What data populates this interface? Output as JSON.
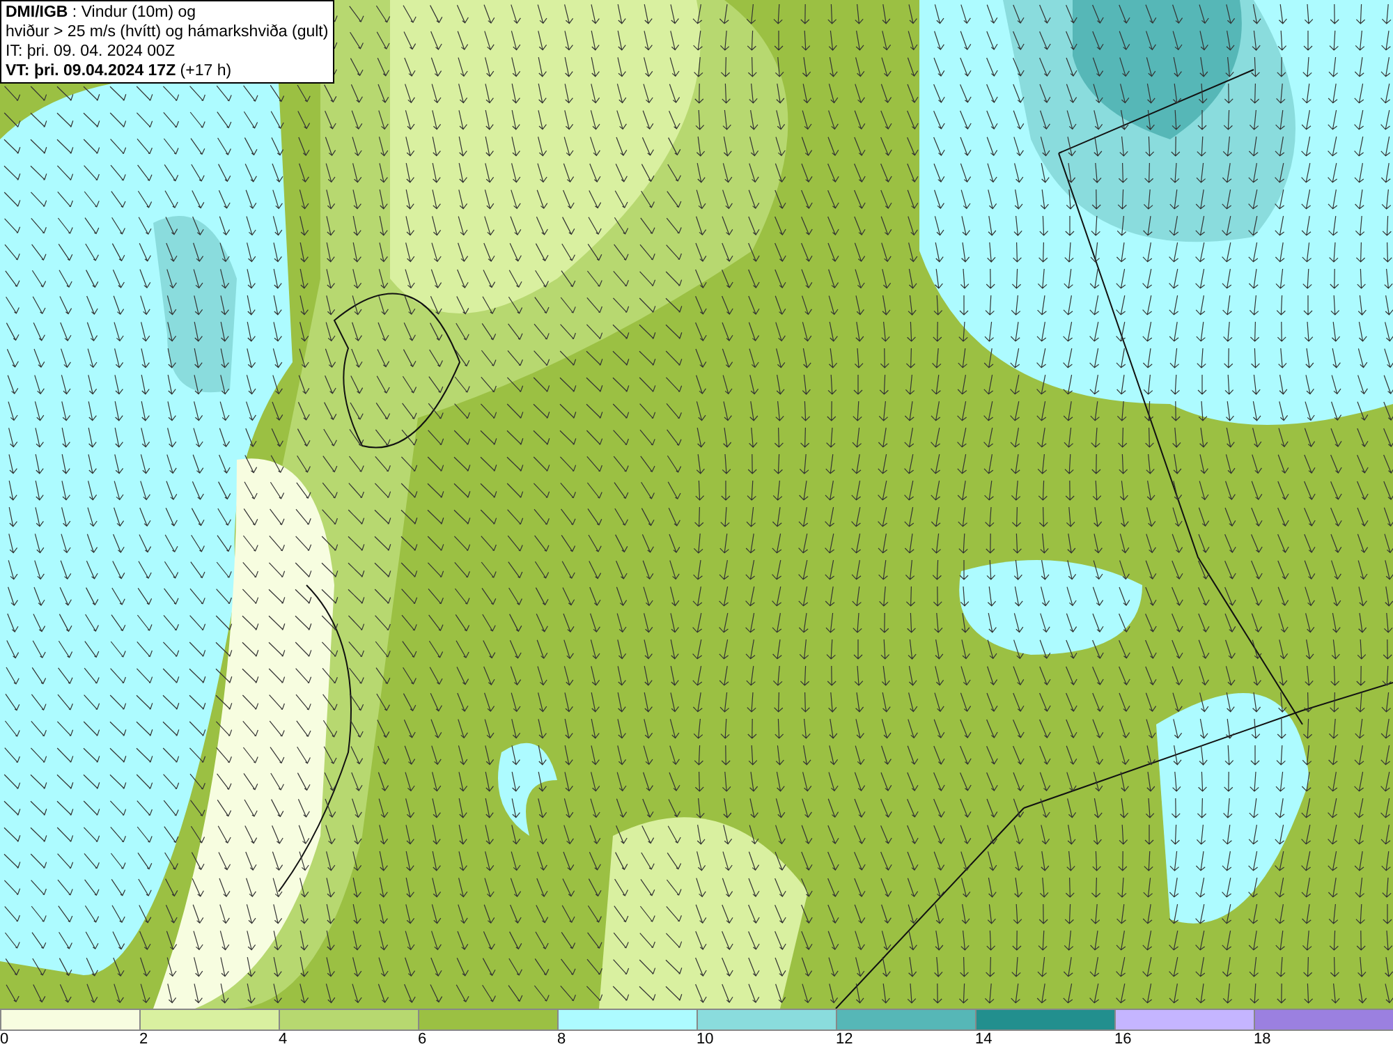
{
  "info_box": {
    "lines": [
      "**DMI/IGB** : Vindur (10m) og",
      "hviður > 25 m/s (hvítt) og hámarkshviða (gult)",
      "IT: þri. 09. 04. 2024 00Z",
      "**VT: þri. 09.04.2024 17Z** (+17 h)"
    ]
  },
  "legend": [
    {
      "label": "0",
      "color": "#f7fde0"
    },
    {
      "label": "2",
      "color": "#d9f0a0"
    },
    {
      "label": "4",
      "color": "#b7d870"
    },
    {
      "label": "6",
      "color": "#9bc043"
    },
    {
      "label": "8",
      "color": "#adfbff"
    },
    {
      "label": "10",
      "color": "#8adcdd"
    },
    {
      "label": "12",
      "color": "#56b7b7"
    },
    {
      "label": "14",
      "color": "#228f8e"
    },
    {
      "label": "16",
      "color": "#c5b5ff"
    },
    {
      "label": "18",
      "color": "#9b80e0"
    }
  ]
}
